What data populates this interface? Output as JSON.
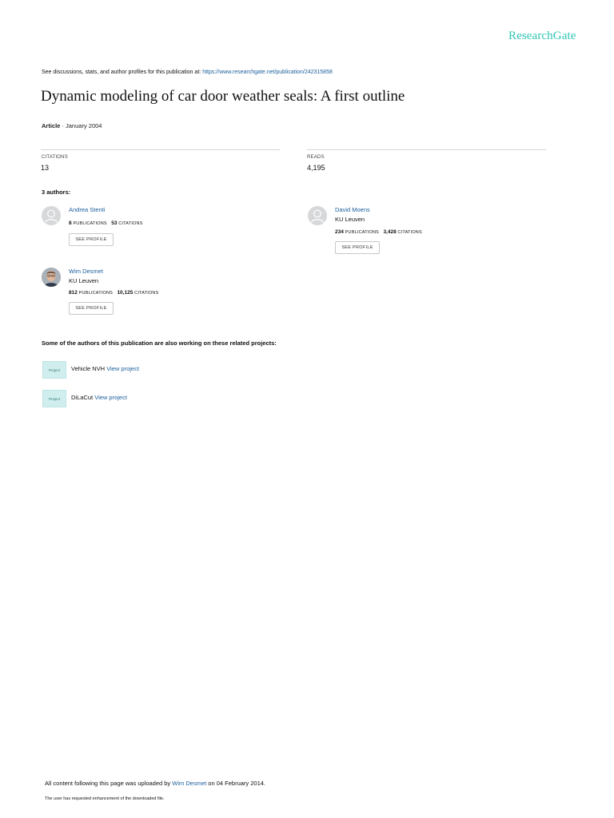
{
  "header": {
    "logo": "ResearchGate",
    "discussions_prefix": "See discussions, stats, and author profiles for this publication at:",
    "publication_url": "https://www.researchgate.net/publication/242315858"
  },
  "publication": {
    "title": "Dynamic modeling of car door weather seals: A first outline",
    "type": "Article",
    "date_separator": " · ",
    "date": "January 2004"
  },
  "stats": {
    "citations_label": "CITATIONS",
    "citations_value": "13",
    "reads_label": "READS",
    "reads_value": "4,195"
  },
  "authors_heading": "3 authors:",
  "authors": [
    {
      "name": "Andrea Stenti",
      "institution": "",
      "publications": "8",
      "publications_label": "PUBLICATIONS",
      "citations": "53",
      "citations_label": "CITATIONS",
      "button": "SEE PROFILE",
      "avatar": "placeholder-avatar"
    },
    {
      "name": "David Moens",
      "institution": "KU Leuven",
      "publications": "234",
      "publications_label": "PUBLICATIONS",
      "citations": "3,428",
      "citations_label": "CITATIONS",
      "button": "SEE PROFILE",
      "avatar": "placeholder-avatar"
    },
    {
      "name": "Wim Desmet",
      "institution": "KU Leuven",
      "publications": "812",
      "publications_label": "PUBLICATIONS",
      "citations": "10,125",
      "citations_label": "CITATIONS",
      "button": "SEE PROFILE",
      "avatar": "photo-avatar"
    }
  ],
  "projects_heading": "Some of the authors of this publication are also working on these related projects:",
  "projects": [
    {
      "icon_label": "Project",
      "name": "Vehicle NVH",
      "link": "View project"
    },
    {
      "icon_label": "Project",
      "name": "DiLaCut",
      "link": "View project"
    }
  ],
  "footer": {
    "uploaded_prefix": "All content following this page was uploaded by",
    "uploader": "Wim Desmet",
    "uploaded_suffix": "on 04 February 2014.",
    "enhancement_note": "The user has requested enhancement of the downloaded file."
  },
  "colors": {
    "brand": "#2ec7b5",
    "link": "#1a5e9c"
  }
}
